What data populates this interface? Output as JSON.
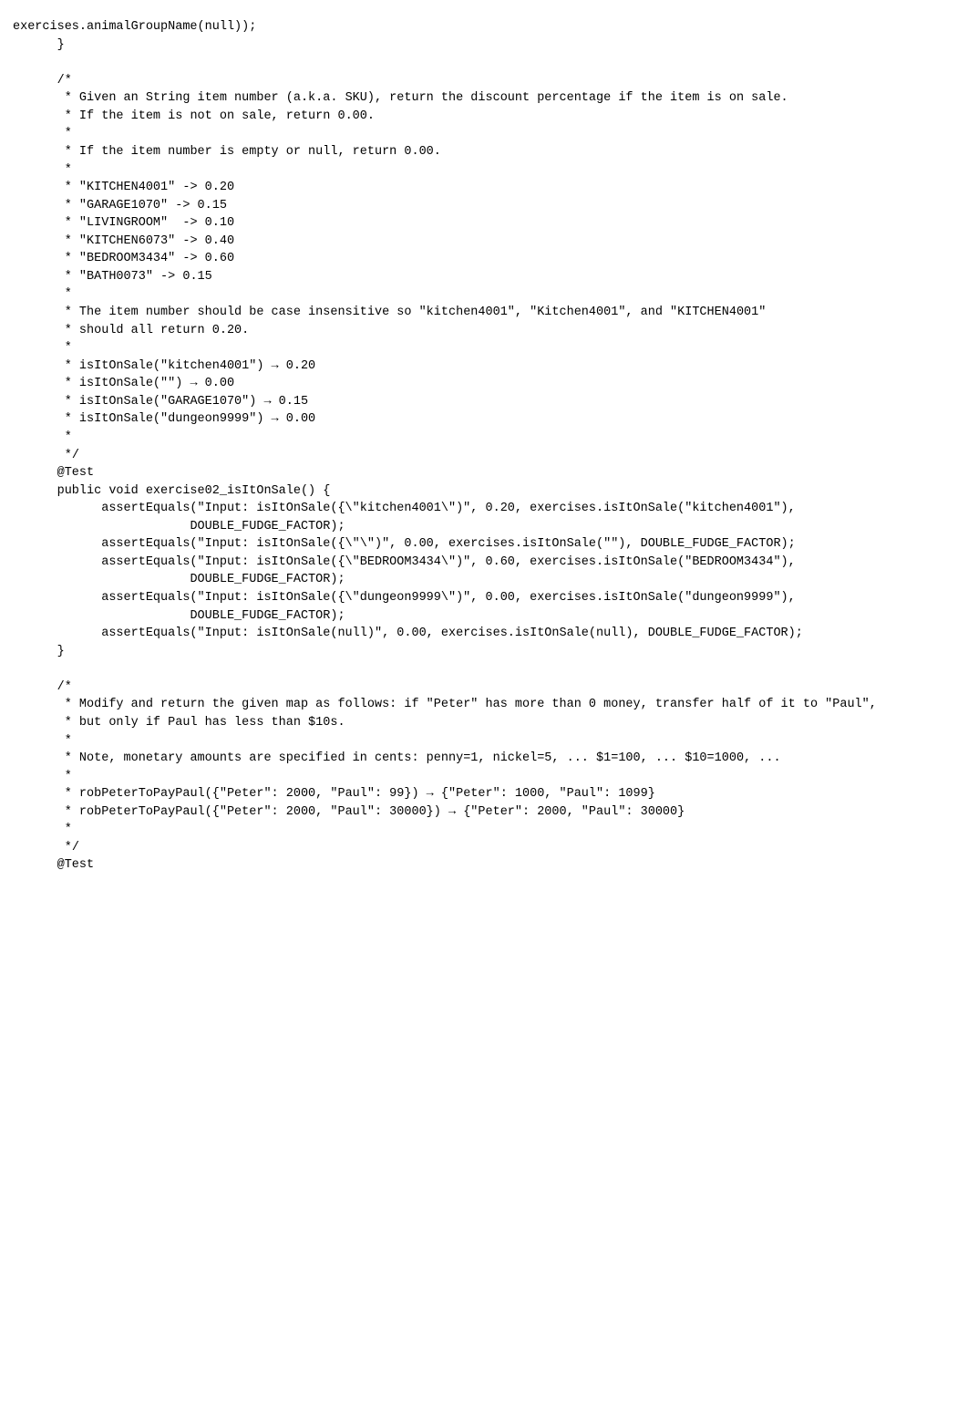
{
  "code": "exercises.animalGroupName(null));\n      }\n\n      /*\n       * Given an String item number (a.k.a. SKU), return the discount percentage if the item is on sale.\n       * If the item is not on sale, return 0.00.\n       *\n       * If the item number is empty or null, return 0.00.\n       *\n       * \"KITCHEN4001\" -> 0.20\n       * \"GARAGE1070\" -> 0.15\n       * \"LIVINGROOM\"  -> 0.10\n       * \"KITCHEN6073\" -> 0.40\n       * \"BEDROOM3434\" -> 0.60\n       * \"BATH0073\" -> 0.15\n       *\n       * The item number should be case insensitive so \"kitchen4001\", \"Kitchen4001\", and \"KITCHEN4001\"\n       * should all return 0.20.\n       *\n       * isItOnSale(\"kitchen4001\") → 0.20\n       * isItOnSale(\"\") → 0.00\n       * isItOnSale(\"GARAGE1070\") → 0.15\n       * isItOnSale(\"dungeon9999\") → 0.00\n       *\n       */\n      @Test\n      public void exercise02_isItOnSale() {\n            assertEquals(\"Input: isItOnSale({\\\"kitchen4001\\\")\", 0.20, exercises.isItOnSale(\"kitchen4001\"),\n                        DOUBLE_FUDGE_FACTOR);\n            assertEquals(\"Input: isItOnSale({\\\"\\\")\", 0.00, exercises.isItOnSale(\"\"), DOUBLE_FUDGE_FACTOR);\n            assertEquals(\"Input: isItOnSale({\\\"BEDROOM3434\\\")\", 0.60, exercises.isItOnSale(\"BEDROOM3434\"),\n                        DOUBLE_FUDGE_FACTOR);\n            assertEquals(\"Input: isItOnSale({\\\"dungeon9999\\\")\", 0.00, exercises.isItOnSale(\"dungeon9999\"),\n                        DOUBLE_FUDGE_FACTOR);\n            assertEquals(\"Input: isItOnSale(null)\", 0.00, exercises.isItOnSale(null), DOUBLE_FUDGE_FACTOR);\n      }\n\n      /*\n       * Modify and return the given map as follows: if \"Peter\" has more than 0 money, transfer half of it to \"Paul\",\n       * but only if Paul has less than $10s.\n       *\n       * Note, monetary amounts are specified in cents: penny=1, nickel=5, ... $1=100, ... $10=1000, ...\n       *\n       * robPeterToPayPaul({\"Peter\": 2000, \"Paul\": 99}) → {\"Peter\": 1000, \"Paul\": 1099}\n       * robPeterToPayPaul({\"Peter\": 2000, \"Paul\": 30000}) → {\"Peter\": 2000, \"Paul\": 30000}\n       *\n       */\n      @Test"
}
